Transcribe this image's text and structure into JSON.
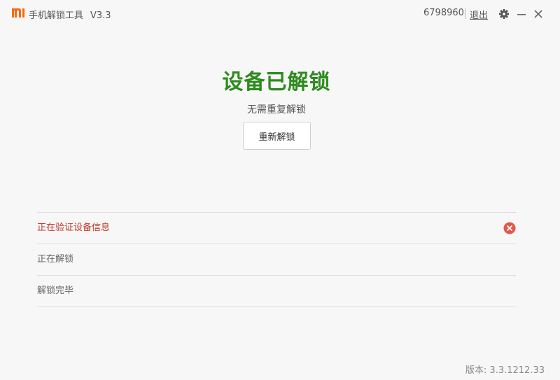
{
  "titlebar": {
    "app_name": "手机解锁工具",
    "app_version": "V3.3",
    "user_id": "6798960",
    "logout_label": "退出",
    "icons": [
      "mi-logo-icon",
      "gear-icon",
      "minimize-icon",
      "close-icon"
    ]
  },
  "status": {
    "title": "设备已解锁",
    "subtitle": "无需重复解锁",
    "button_label": "重新解锁"
  },
  "steps": [
    {
      "label": "正在验证设备信息",
      "state": "error"
    },
    {
      "label": "正在解锁",
      "state": "pending"
    },
    {
      "label": "解锁完毕",
      "state": "pending"
    }
  ],
  "footer": {
    "version": "版本: 3.3.1212.33"
  },
  "colors": {
    "brand": "#ff6700",
    "success": "#2e8b1e",
    "error": "#c0392b",
    "error_icon": "#e05a4a"
  }
}
